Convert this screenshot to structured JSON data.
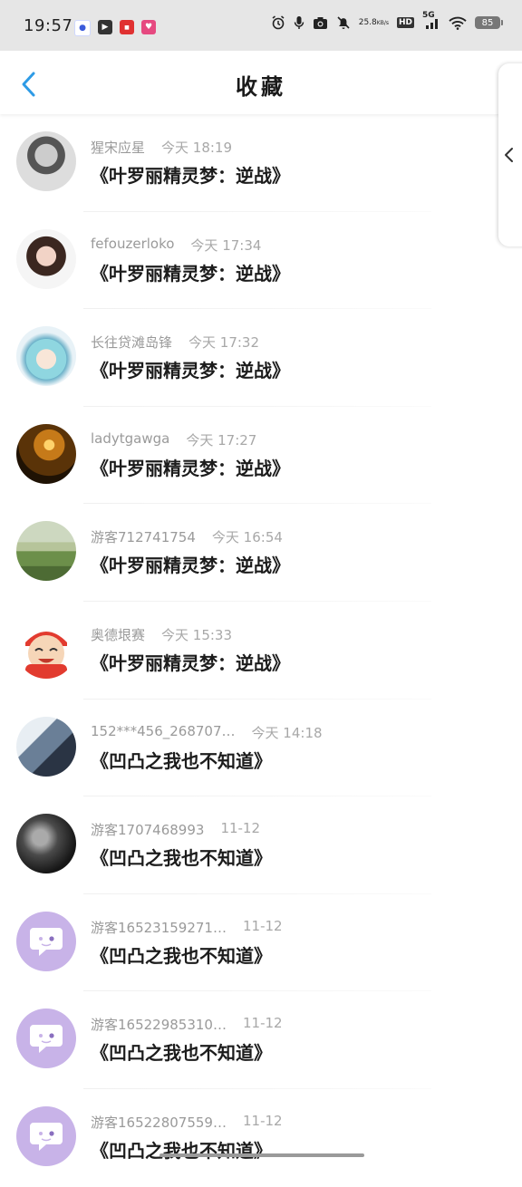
{
  "status_bar": {
    "time": "19:57",
    "net_speed_value": "25.8",
    "net_speed_unit": "KB/s",
    "hd_label": "HD",
    "network_label": "5G",
    "battery": "85",
    "notif_icons": [
      "baidu-icon",
      "media-icon",
      "app-red-icon",
      "app-pink-icon"
    ]
  },
  "header": {
    "title": "收藏",
    "back_icon": "chevron-left-icon"
  },
  "side_handle": {
    "icon": "chevron-left-icon"
  },
  "colors": {
    "accent_blue": "#2e9be6",
    "title_text": "#1c1c1c",
    "meta_text": "#9a9a9a",
    "default_avatar": "#c8b3e8"
  },
  "favorites": [
    {
      "username": "猩宋应星",
      "time": "今天  18:19",
      "book": "《叶罗丽精灵梦：逆战》"
    },
    {
      "username": "fefouzerloko",
      "time": "今天  17:34",
      "book": "《叶罗丽精灵梦：逆战》"
    },
    {
      "username": "长往贷滩岛锋",
      "time": "今天  17:32",
      "book": "《叶罗丽精灵梦：逆战》"
    },
    {
      "username": "ladytgawga",
      "time": "今天  17:27",
      "book": "《叶罗丽精灵梦：逆战》"
    },
    {
      "username": "游客712741754",
      "time": "今天  16:54",
      "book": "《叶罗丽精灵梦：逆战》"
    },
    {
      "username": "奥德垠赛",
      "time": "今天  15:33",
      "book": "《叶罗丽精灵梦：逆战》"
    },
    {
      "username": "152***456_268707…",
      "time": "今天  14:18",
      "book": "《凹凸之我也不知道》"
    },
    {
      "username": "游客1707468993",
      "time": "11-12",
      "book": "《凹凸之我也不知道》"
    },
    {
      "username": "游客16523159271…",
      "time": "11-12",
      "book": "《凹凸之我也不知道》"
    },
    {
      "username": "游客16522985310…",
      "time": "11-12",
      "book": "《凹凸之我也不知道》"
    },
    {
      "username": "游客16522807559…",
      "time": "11-12",
      "book": "《凹凸之我也不知道》"
    }
  ]
}
